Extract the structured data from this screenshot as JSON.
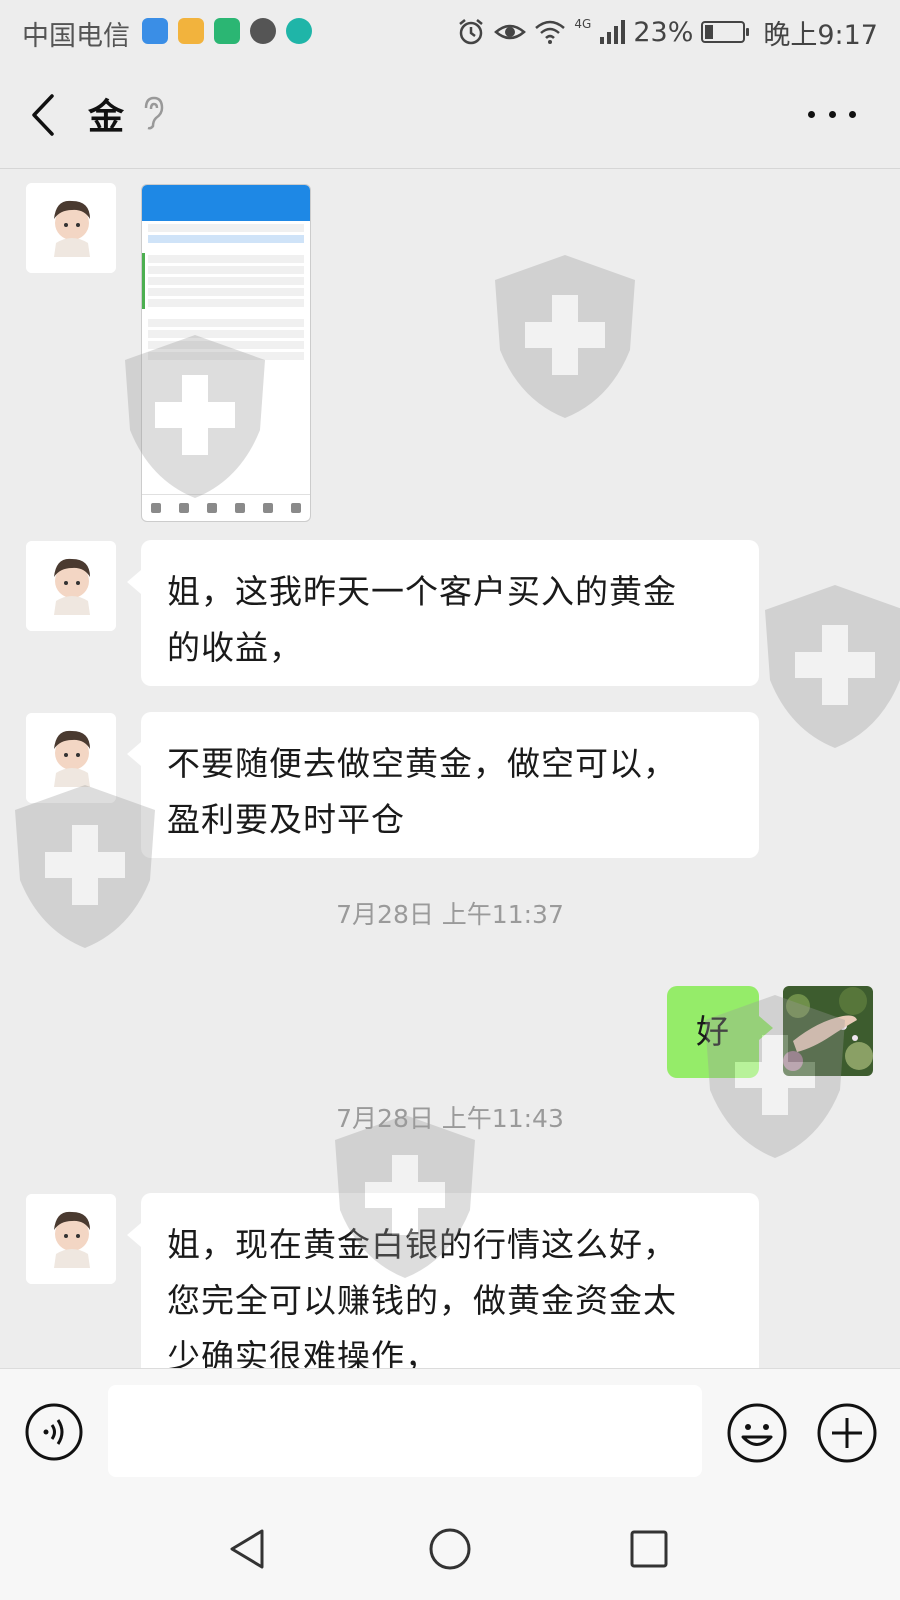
{
  "status_bar": {
    "carrier": "中国电信",
    "network": "4G",
    "battery_text": "23%",
    "battery_level": 0.23,
    "time": "晚上9:17"
  },
  "header": {
    "title": "金",
    "back_icon": "back-arrow-icon",
    "more_icon": "more-dots-icon"
  },
  "messages": [
    {
      "side": "left",
      "type": "image",
      "desc_icon": "trading-screenshot"
    },
    {
      "side": "left",
      "type": "text",
      "lines": [
        "姐，这我昨天一个客户买入的黄金",
        "的收益，"
      ]
    },
    {
      "side": "left",
      "type": "text",
      "lines": [
        "不要随便去做空黄金，做空可以，",
        "盈利要及时平仓"
      ]
    },
    {
      "side": "time",
      "text": "7月28日 上午11:37"
    },
    {
      "side": "right",
      "type": "text",
      "lines": [
        "好"
      ]
    },
    {
      "side": "time",
      "text": "7月28日 上午11:43"
    },
    {
      "side": "left",
      "type": "text",
      "lines": [
        "姐，现在黄金白银的行情这么好，",
        "您完全可以赚钱的，做黄金资金太",
        "少确实很难操作，"
      ]
    }
  ],
  "input_bar": {
    "placeholder": "",
    "voice_icon": "voice-icon",
    "emoji_icon": "emoji-icon",
    "plus_icon": "plus-icon"
  },
  "nav_bar": {
    "back_icon": "nav-back-icon",
    "home_icon": "nav-home-icon",
    "recents_icon": "nav-recents-icon"
  },
  "colors": {
    "background": "#ededed",
    "bubble_left": "#ffffff",
    "bubble_right": "#95ec69",
    "timestamp": "#9a9a9a"
  }
}
